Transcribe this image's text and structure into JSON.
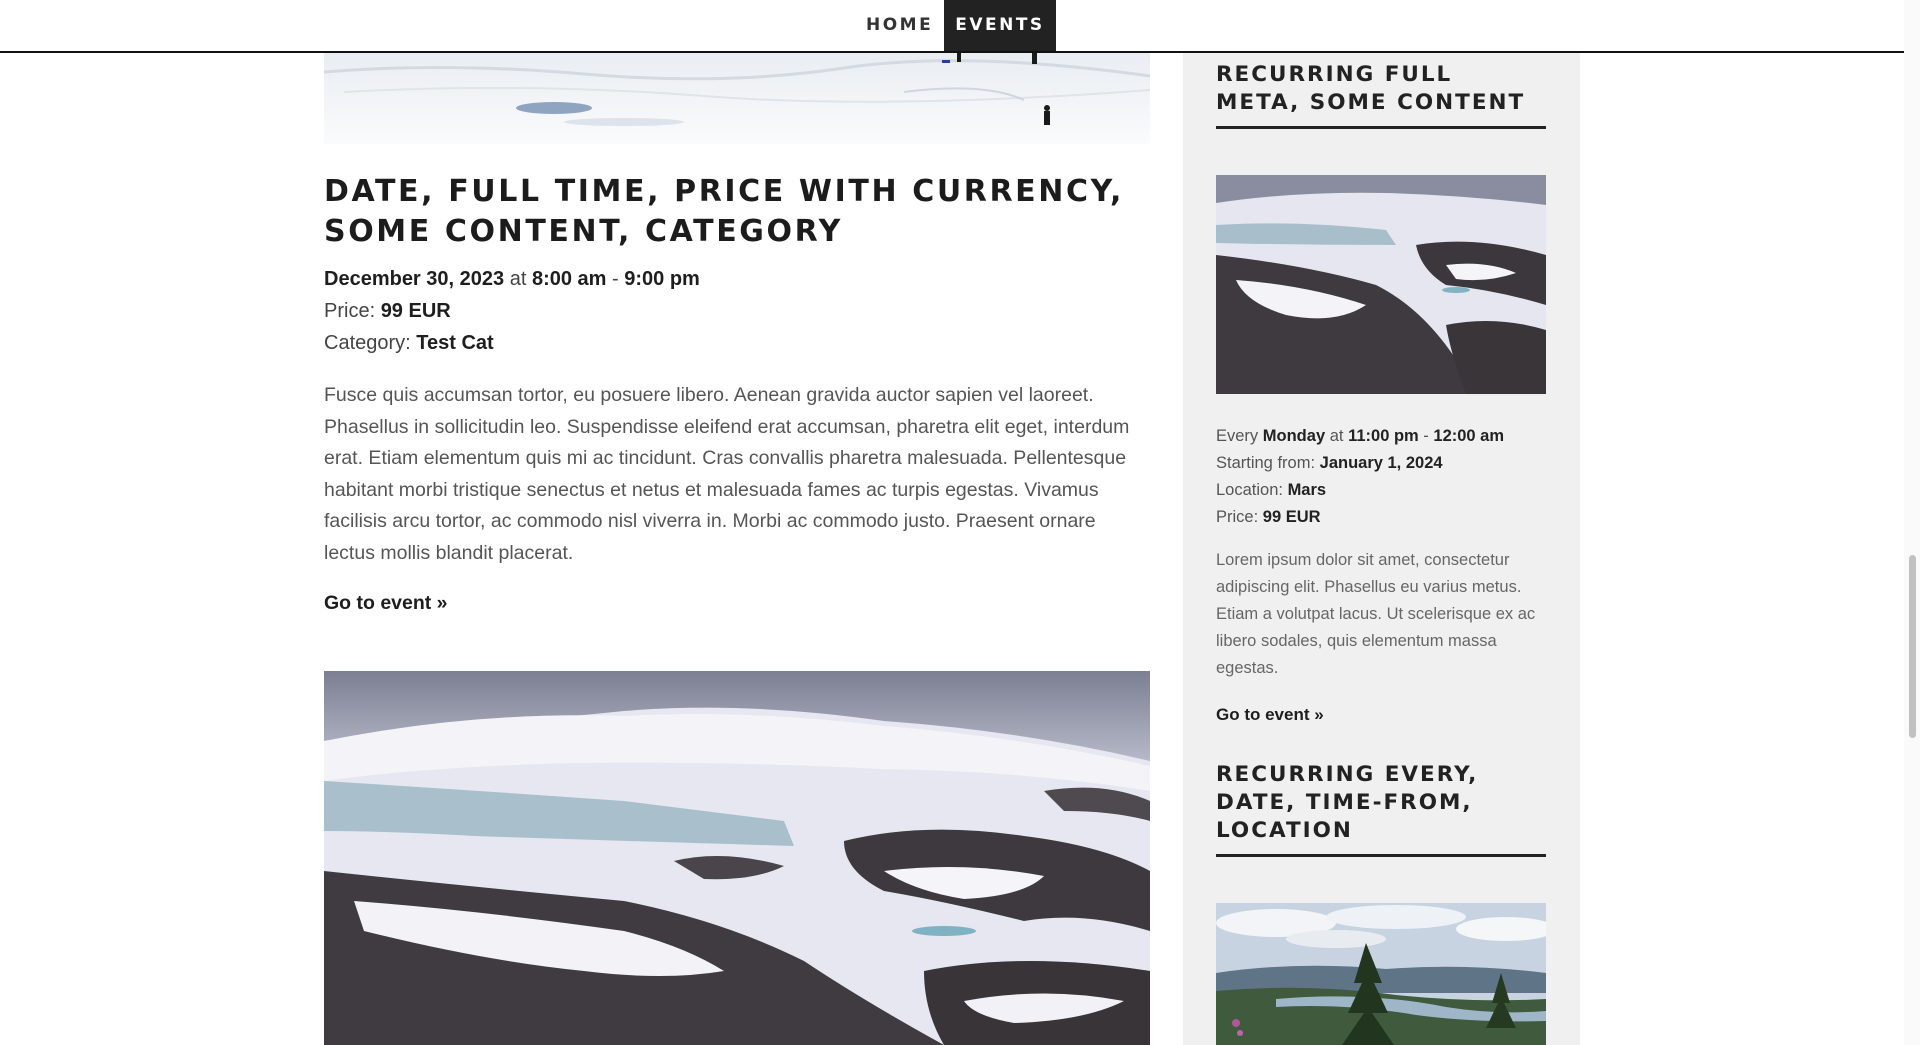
{
  "nav": {
    "items": [
      {
        "label": "HOME",
        "active": false
      },
      {
        "label": "EVENTS",
        "active": true
      }
    ]
  },
  "main": {
    "title": "DATE, FULL TIME, PRICE WITH CURRENCY, SOME CONTENT, CATEGORY",
    "date": "December 30, 2023",
    "at": "at",
    "time_from": "8:00 am",
    "time_sep": "-",
    "time_to": "9:00 pm",
    "price_label": "Price:",
    "price": "99 EUR",
    "category_label": "Category:",
    "category": "Test Cat",
    "excerpt": "Fusce quis accumsan tortor, eu posuere libero. Aenean gravida auctor sapien vel laoreet. Phasellus in sollicitudin leo. Suspendisse eleifend erat accumsan, pharetra elit eget, interdum erat. Etiam elementum quis mi ac tincidunt. Cras convallis pharetra malesuada. Pellentesque habitant morbi tristique senectus et netus et malesuada fames ac turpis egestas. Vivamus facilisis arcu tortor, ac commodo nisl viverra in. Morbi ac commodo justo. Praesent ornare lectus mollis blandit placerat.",
    "go_link": "Go to event »"
  },
  "sidebar": {
    "event1": {
      "title": "RECURRING FULL META, SOME CONTENT",
      "every_label": "Every",
      "day": "Monday",
      "at": "at",
      "time_from": "11:00 pm",
      "time_sep": "-",
      "time_to": "12:00 am",
      "starting_label": "Starting from:",
      "starting": "January 1, 2024",
      "location_label": "Location:",
      "location": "Mars",
      "price_label": "Price:",
      "price": "99 EUR",
      "description": "Lorem ipsum dolor sit amet, consectetur adipiscing elit. Phasellus eu varius metus. Etiam a volutpat lacus. Ut scelerisque ex ac libero sodales, quis elementum massa egestas.",
      "go_link": "Go to event »"
    },
    "event2": {
      "title": "RECURRING EVERY, DATE, TIME-FROM, LOCATION"
    }
  }
}
